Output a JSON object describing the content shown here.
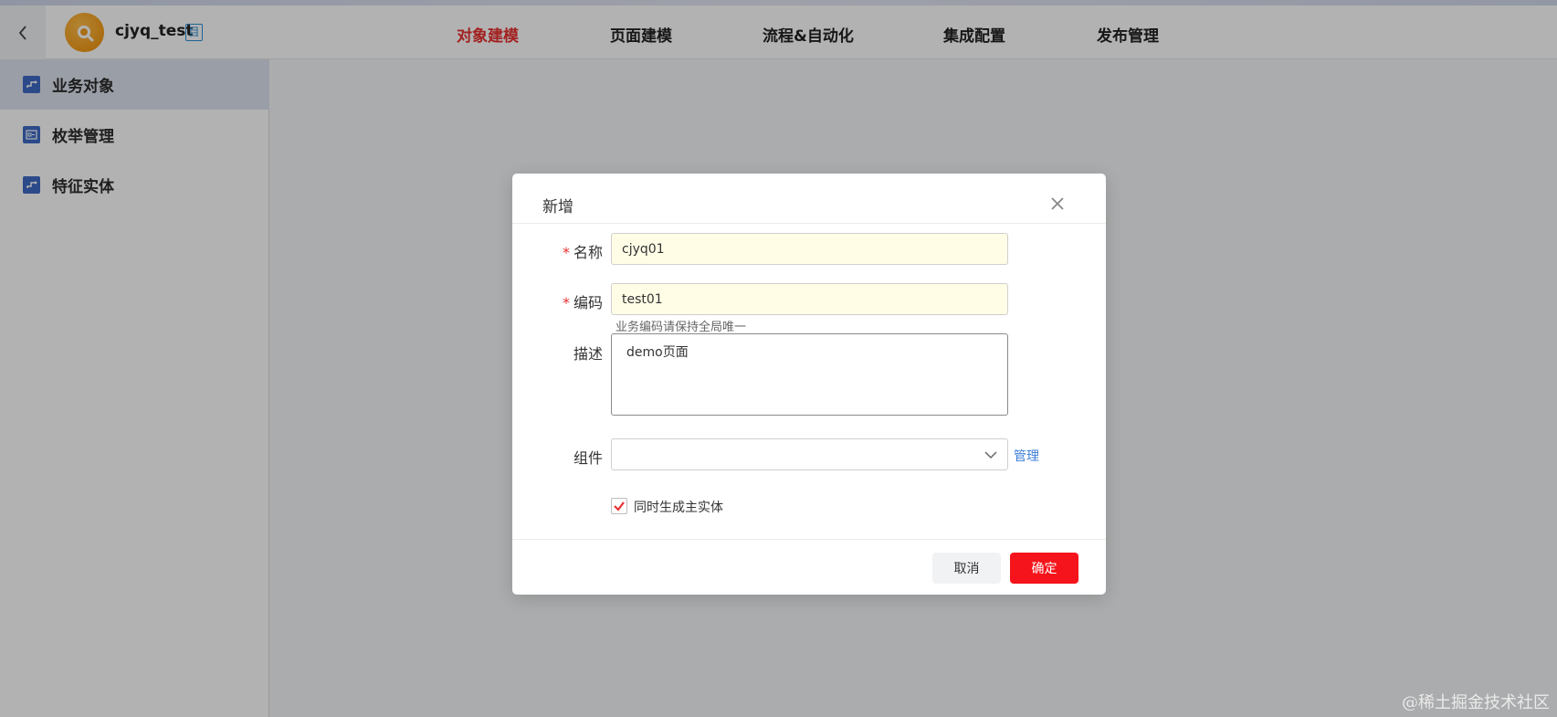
{
  "header": {
    "app_name": "cjyq_test",
    "badge_text": "目",
    "nav": [
      {
        "label": "对象建模",
        "active": true
      },
      {
        "label": "页面建模",
        "active": false
      },
      {
        "label": "流程&自动化",
        "active": false
      },
      {
        "label": "集成配置",
        "active": false
      },
      {
        "label": "发布管理",
        "active": false
      }
    ]
  },
  "sidebar": {
    "items": [
      {
        "label": "业务对象",
        "icon": "link-icon",
        "active": true
      },
      {
        "label": "枚举管理",
        "icon": "enum-icon",
        "active": false
      },
      {
        "label": "特征实体",
        "icon": "link-icon",
        "active": false
      }
    ]
  },
  "modal": {
    "title": "新增",
    "fields": {
      "name": {
        "label": "名称",
        "required": true,
        "value": "cjyq01"
      },
      "code": {
        "label": "编码",
        "required": true,
        "value": "test01",
        "hint": "业务编码请保持全局唯一"
      },
      "description": {
        "label": "描述",
        "value": "demo页面"
      },
      "component": {
        "label": "组件",
        "value": "",
        "manage_link": "管理"
      }
    },
    "checkbox": {
      "label": "同时生成主实体",
      "checked": true
    },
    "buttons": {
      "cancel": "取消",
      "confirm": "确定"
    }
  },
  "watermark": "@稀土掘金技术社区",
  "colors": {
    "accent_red": "#e8302f",
    "confirm_red": "#f5141b",
    "link_blue": "#3b7dd8",
    "sidebar_icon": "#3e6bc6"
  }
}
